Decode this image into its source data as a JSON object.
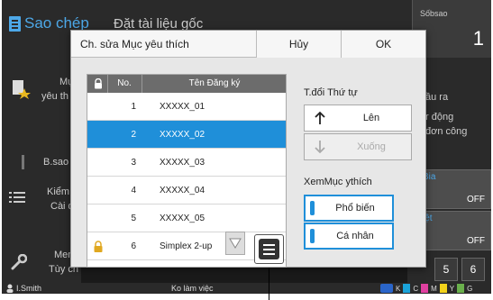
{
  "app": {
    "title": "Sao chép",
    "doc_setting": "Đặt tài liệu gốc"
  },
  "copies": {
    "label": "Sốbsao",
    "value": "1"
  },
  "left_panel": {
    "favorites_label": [
      "Mụ",
      "yêu th"
    ],
    "bsao_label": "B.sao",
    "check_label": [
      "Kiểm",
      "Cài đ"
    ],
    "menu_label": [
      "Men",
      "Tùy ch"
    ]
  },
  "right_panel": {
    "output_label": "ầu ra",
    "auto_label": [
      "r động",
      "đơn công"
    ],
    "btn1_label": "Bia",
    "btn1_value": "OFF",
    "btn2_label": "iệt",
    "btn2_value": "OFF",
    "pages": [
      "5",
      "6"
    ]
  },
  "status_bar": {
    "user": "I.Smith",
    "mode": "Ko làm việc",
    "ink": [
      "K",
      "C",
      "M",
      "Y",
      "G"
    ],
    "ink_colors": [
      "#2a65c9",
      "#1aa3d9",
      "#e040a0",
      "#f2d21a",
      "#6ab04c"
    ]
  },
  "dialog": {
    "title": "Ch. sửa Mục yêu thích",
    "cancel": "Hủy",
    "ok": "OK",
    "table": {
      "headers": {
        "no": "No.",
        "name": "Tên Đăng ký"
      },
      "rows": [
        {
          "no": "1",
          "name": "XXXXX_01",
          "locked": false,
          "selected": false
        },
        {
          "no": "2",
          "name": "XXXXX_02",
          "locked": false,
          "selected": true
        },
        {
          "no": "3",
          "name": "XXXXX_03",
          "locked": false,
          "selected": false
        },
        {
          "no": "4",
          "name": "XXXXX_04",
          "locked": false,
          "selected": false
        },
        {
          "no": "5",
          "name": "XXXXX_05",
          "locked": false,
          "selected": false
        },
        {
          "no": "6",
          "name": "Simplex 2-up",
          "locked": true,
          "selected": false
        }
      ]
    },
    "order": {
      "label": "T.đổi Thứ tự",
      "up": "Lên",
      "down": "Xuống"
    },
    "view": {
      "label": "XemMục ythích",
      "common": "Phổ biến",
      "personal": "Cá nhân"
    }
  },
  "colors": {
    "accent": "#1f8fd9",
    "lock": "#e0a820"
  }
}
